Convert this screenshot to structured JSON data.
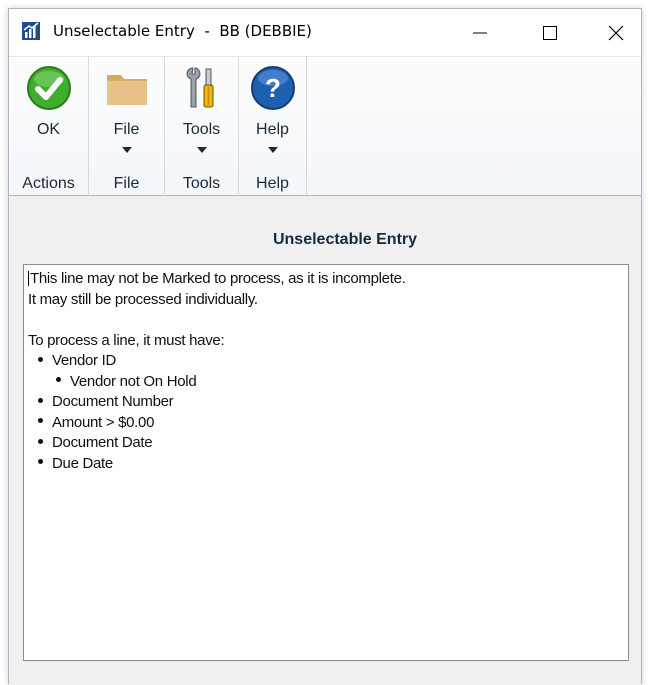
{
  "window": {
    "title": "Unselectable Entry  -  BB (DEBBIE)"
  },
  "ribbon": {
    "groups": [
      {
        "label": "Actions",
        "button": {
          "label": "OK",
          "icon": "ok-check-icon",
          "has_caret": false
        }
      },
      {
        "label": "File",
        "button": {
          "label": "File",
          "icon": "folder-icon",
          "has_caret": true
        }
      },
      {
        "label": "Tools",
        "button": {
          "label": "Tools",
          "icon": "tools-icon",
          "has_caret": true
        }
      },
      {
        "label": "Help",
        "button": {
          "label": "Help",
          "icon": "help-question-icon",
          "has_caret": true
        }
      }
    ]
  },
  "content": {
    "heading": "Unselectable Entry",
    "message": {
      "line1": "This line may not be Marked to process, as it is incomplete.",
      "line2": "It may still be processed individually.",
      "line3": "To process a line, it must have:",
      "bullets": [
        {
          "text": "Vendor ID",
          "level": 1
        },
        {
          "text": "Vendor not On Hold",
          "level": 2
        },
        {
          "text": "Document Number",
          "level": 1
        },
        {
          "text": "Amount > $0.00",
          "level": 1
        },
        {
          "text": "Document Date",
          "level": 1
        },
        {
          "text": "Due Date",
          "level": 1
        }
      ]
    }
  },
  "colors": {
    "ok_green": "#3fae2a",
    "folder_tan": "#e2b873",
    "help_blue": "#1f5fb0",
    "border": "#aab4c4"
  }
}
